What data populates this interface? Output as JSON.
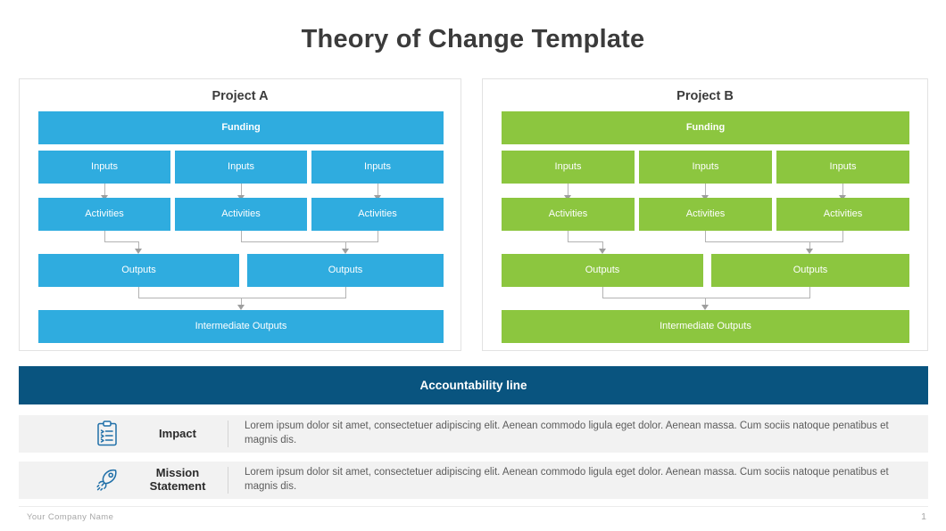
{
  "slide": {
    "title": "Theory of Change Template"
  },
  "projects": [
    {
      "id": "project-a",
      "title": "Project A",
      "color": "#2FACDF",
      "funding": "Funding",
      "inputs": [
        "Inputs",
        "Inputs",
        "Inputs"
      ],
      "activities": [
        "Activities",
        "Activities",
        "Activities"
      ],
      "outputs": [
        "Outputs",
        "Outputs"
      ],
      "intermediate": "Intermediate Outputs"
    },
    {
      "id": "project-b",
      "title": "Project B",
      "color": "#8CC63F",
      "funding": "Funding",
      "inputs": [
        "Inputs",
        "Inputs",
        "Inputs"
      ],
      "activities": [
        "Activities",
        "Activities",
        "Activities"
      ],
      "outputs": [
        "Outputs",
        "Outputs"
      ],
      "intermediate": "Intermediate Outputs"
    }
  ],
  "accountability": {
    "label": "Accountability line",
    "color": "#09547F"
  },
  "info_rows": [
    {
      "id": "impact",
      "icon": "clipboard-icon",
      "label": "Impact",
      "text": "Lorem ipsum dolor sit amet, consectetuer adipiscing elit. Aenean commodo  ligula eget dolor. Aenean massa. Cum sociis natoque penatibus et magnis dis."
    },
    {
      "id": "mission-statement",
      "icon": "rocket-icon",
      "label": "Mission Statement",
      "text": "Lorem ipsum dolor sit amet, consectetuer adipiscing elit. Aenean commodo  ligula eget dolor. Aenean massa. Cum sociis natoque penatibus et magnis dis."
    }
  ],
  "footer": {
    "company": "Your Company Name",
    "page_number": "1"
  }
}
